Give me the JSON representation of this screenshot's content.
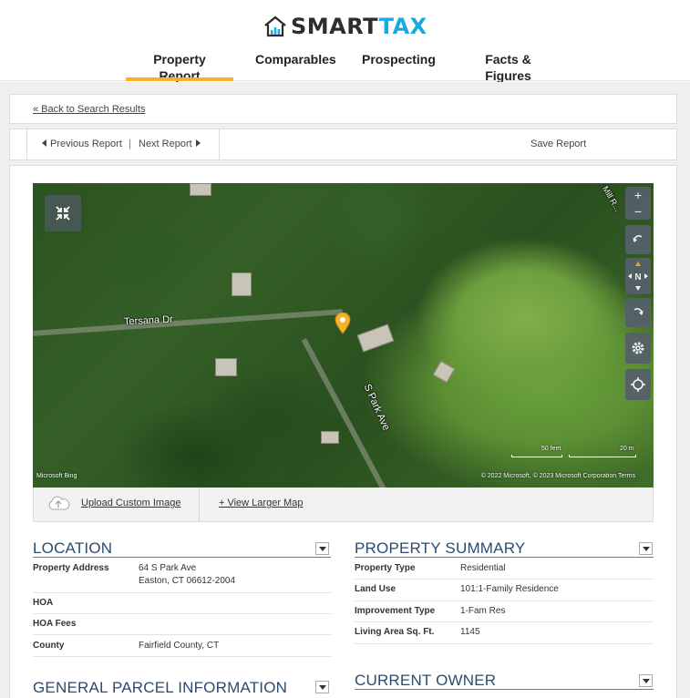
{
  "brand": {
    "name_part1": "SMART",
    "name_part2": "TAX"
  },
  "nav": {
    "tabs": [
      {
        "label": "Property Report",
        "active": true
      },
      {
        "label": "Comparables",
        "active": false
      },
      {
        "label": "Prospecting",
        "active": false
      },
      {
        "label": "Facts & Figures",
        "active": false
      }
    ]
  },
  "links": {
    "back": "« Back to Search Results",
    "previous": "Previous Report",
    "separator": "|",
    "next": "Next Report",
    "save": "Save Report"
  },
  "map": {
    "labels": {
      "street1": "Tersana Dr",
      "street2": "S Park Ave",
      "street3": "Mill R..."
    },
    "zoom_in": "+",
    "zoom_out": "−",
    "compass": "N",
    "scale": {
      "feet": "50 feet",
      "meters": "20 m"
    },
    "attribution": "© 2022 Microsoft, © 2023 Microsoft Corporation  Terms",
    "provider": "Microsoft Bing",
    "upload_label": "Upload Custom Image",
    "larger_map_label": "+ View Larger Map"
  },
  "location": {
    "title": "LOCATION",
    "rows": [
      {
        "label": "Property Address",
        "value_line1": "64 S Park Ave",
        "value_line2": "Easton, CT 06612-2004"
      },
      {
        "label": "HOA",
        "value": ""
      },
      {
        "label": "HOA Fees",
        "value": ""
      },
      {
        "label": "County",
        "value": "Fairfield County, CT"
      }
    ]
  },
  "summary": {
    "title": "PROPERTY SUMMARY",
    "rows": [
      {
        "label": "Property Type",
        "value": "Residential"
      },
      {
        "label": "Land Use",
        "value": "101:1-Family Residence"
      },
      {
        "label": "Improvement Type",
        "value": "1-Fam Res"
      },
      {
        "label": "Living Area Sq. Ft.",
        "value": "1145"
      }
    ]
  },
  "parcel": {
    "title": "GENERAL PARCEL INFORMATION"
  },
  "owner": {
    "title": "CURRENT OWNER"
  },
  "colors": {
    "accent": "#f6b12a",
    "brand_blue": "#1aa9e0",
    "heading": "#2d4b6f"
  }
}
